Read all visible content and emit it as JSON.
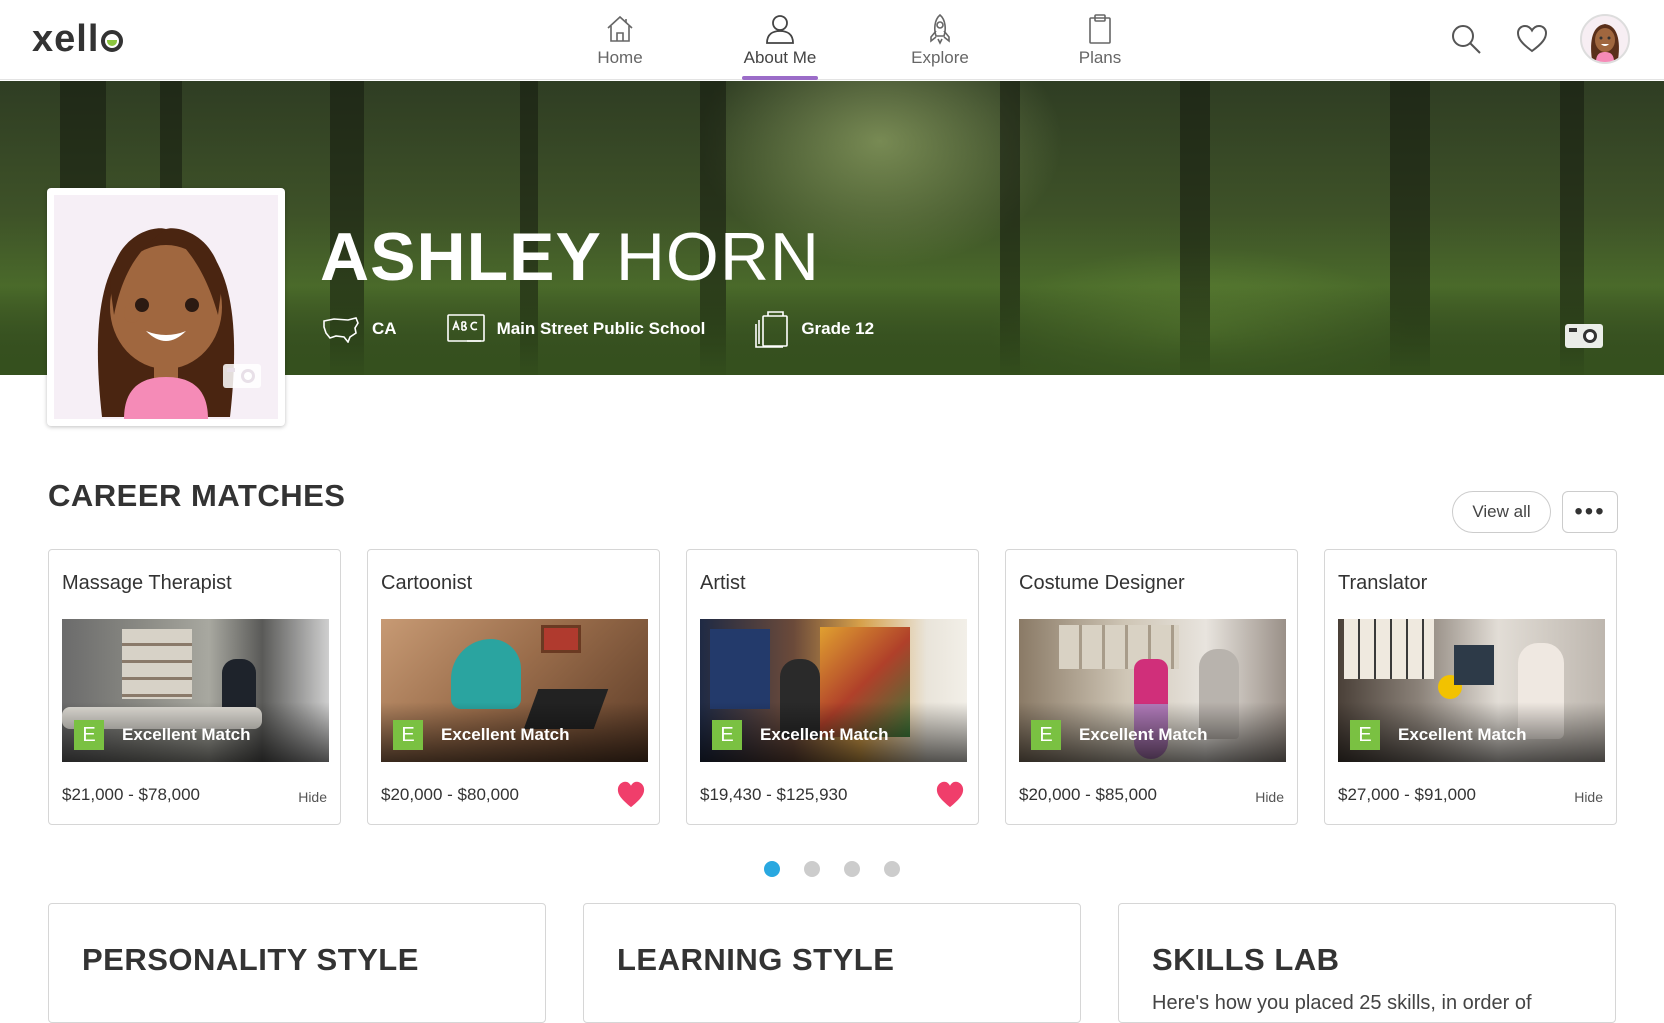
{
  "brand": {
    "logo_text": "xell",
    "accent": "#9b6cc8"
  },
  "nav": {
    "items": [
      {
        "label": "Home",
        "icon": "home-icon"
      },
      {
        "label": "About Me",
        "icon": "user-icon",
        "active": true
      },
      {
        "label": "Explore",
        "icon": "rocket-icon"
      },
      {
        "label": "Plans",
        "icon": "clipboard-icon"
      }
    ]
  },
  "top_actions": {
    "search_icon": "search-icon",
    "favorites_icon": "heart-icon",
    "avatar": "avatar"
  },
  "profile": {
    "first_name": "ASHLEY",
    "last_name": "HORN",
    "region": "CA",
    "school": "Main Street Public School",
    "grade": "Grade 12"
  },
  "career_matches": {
    "title": "CAREER MATCHES",
    "view_all_label": "View all",
    "more_label": "•••",
    "cards": [
      {
        "title": "Massage Therapist",
        "badge": "E",
        "match": "Excellent Match",
        "salary": "$21,000 - $78,000",
        "action": "Hide",
        "favorited": false
      },
      {
        "title": "Cartoonist",
        "badge": "E",
        "match": "Excellent Match",
        "salary": "$20,000 - $80,000",
        "action": "",
        "favorited": true
      },
      {
        "title": "Artist",
        "badge": "E",
        "match": "Excellent Match",
        "salary": "$19,430 - $125,930",
        "action": "",
        "favorited": true
      },
      {
        "title": "Costume Designer",
        "badge": "E",
        "match": "Excellent Match",
        "salary": "$20,000 - $85,000",
        "action": "Hide",
        "favorited": false
      },
      {
        "title": "Translator",
        "badge": "E",
        "match": "Excellent Match",
        "salary": "$27,000 - $91,000",
        "action": "Hide",
        "favorited": false
      }
    ],
    "pagination": {
      "pages": 4,
      "current": 1
    }
  },
  "sections": [
    {
      "title": "PERSONALITY STYLE",
      "subtitle": ""
    },
    {
      "title": "LEARNING STYLE",
      "subtitle": ""
    },
    {
      "title": "SKILLS LAB",
      "subtitle": "Here's how you placed 25 skills, in order of"
    }
  ],
  "colors": {
    "match_badge": "#7ac142",
    "heart": "#f03e6b",
    "dot_active": "#29a8e0"
  }
}
